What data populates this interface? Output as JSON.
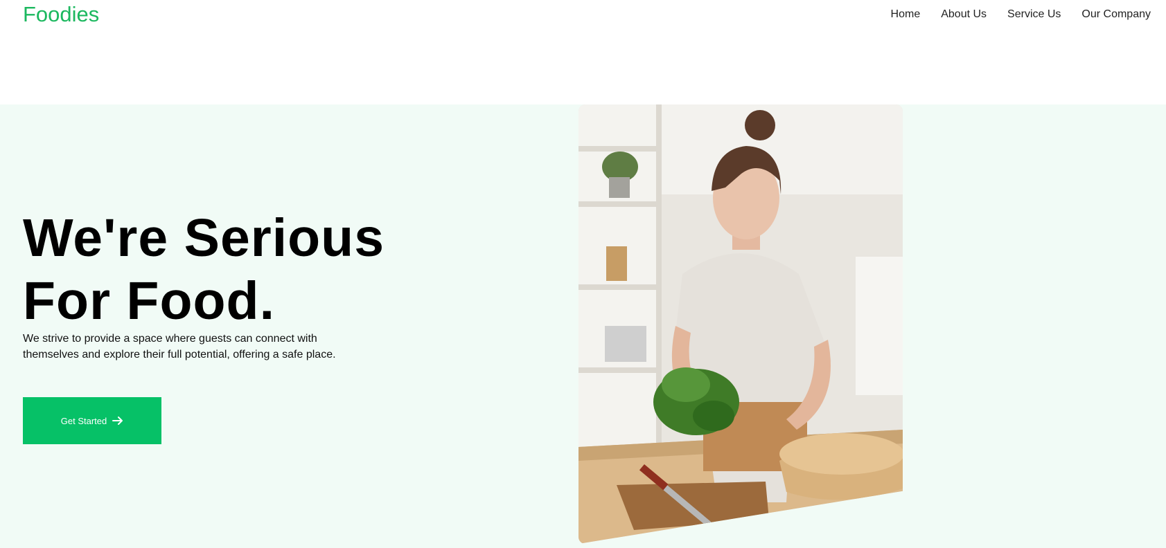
{
  "header": {
    "brand": "Foodies",
    "nav": [
      {
        "label": "Home"
      },
      {
        "label": "About Us"
      },
      {
        "label": "Service Us"
      },
      {
        "label": "Our Company"
      }
    ]
  },
  "hero": {
    "title_line1": "We're Serious",
    "title_line2": "For Food.",
    "description": "We strive to provide a space where guests can connect with themselves and explore their full potential, offering a safe place.",
    "cta_label": "Get Started",
    "cta_icon": "arrow-right-icon",
    "image_alt": "Woman preparing lettuce in a kitchen"
  },
  "colors": {
    "brand": "#1cb85f",
    "accent": "#06c167",
    "hero_bg": "#f1fbf6",
    "text": "#000000"
  }
}
